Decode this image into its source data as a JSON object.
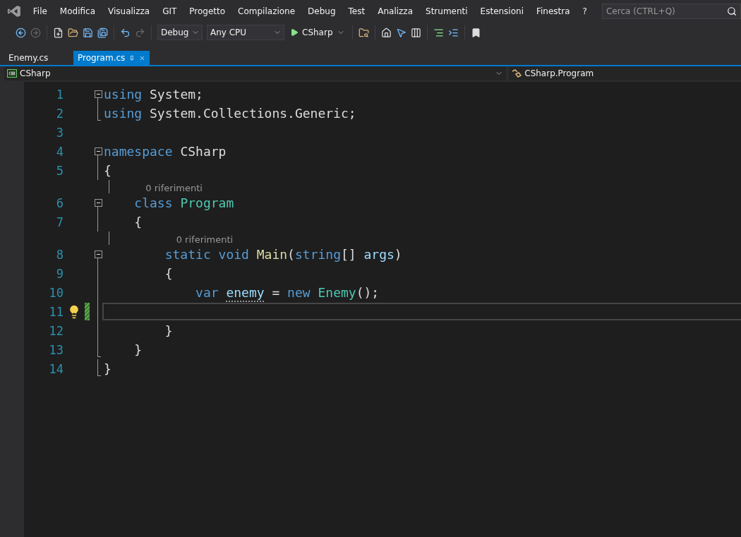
{
  "menu": {
    "items": [
      "File",
      "Modifica",
      "Visualizza",
      "GIT",
      "Progetto",
      "Compilazione",
      "Debug",
      "Test",
      "Analizza",
      "Strumenti",
      "Estensioni",
      "Finestra",
      "?"
    ]
  },
  "search": {
    "placeholder": "Cerca (CTRL+Q)"
  },
  "toolbar": {
    "configuration": "Debug",
    "platform": "Any CPU",
    "run_target": "CSharp"
  },
  "tabs": [
    {
      "label": "Enemy.cs",
      "selected": false
    },
    {
      "label": "Program.cs",
      "selected": true
    }
  ],
  "navigation": {
    "project": "CSharp",
    "member": "CSharp.Program"
  },
  "editor": {
    "lines": [
      {
        "number": "1",
        "kind": "fold-start",
        "tokens": [
          {
            "text": "using ",
            "kind": "keyword"
          },
          {
            "text": "System;",
            "kind": "plain"
          }
        ]
      },
      {
        "number": "2",
        "kind": "fold-end",
        "tokens": [
          {
            "text": "using ",
            "kind": "keyword"
          },
          {
            "text": "System.Collections.Generic;",
            "kind": "plain"
          }
        ]
      },
      {
        "number": "3",
        "kind": "blank"
      },
      {
        "number": "4",
        "kind": "fold-start",
        "tokens": [
          {
            "text": "namespace ",
            "kind": "keyword"
          },
          {
            "text": "CSharp",
            "kind": "plain"
          }
        ]
      },
      {
        "number": "5",
        "kind": "fold-body",
        "tokens": [
          {
            "text": "{",
            "kind": "plain"
          }
        ]
      },
      {
        "number": "6",
        "kind": "fold-start",
        "lens": "0 riferimenti",
        "tokens": [
          {
            "text": "    class ",
            "kind": "keyword"
          },
          {
            "text": "Program",
            "kind": "type"
          }
        ]
      },
      {
        "number": "7",
        "kind": "fold-body",
        "tokens": [
          {
            "text": "    {",
            "kind": "plain"
          }
        ]
      },
      {
        "number": "8",
        "kind": "fold-start",
        "lens": "0 riferimenti",
        "tokens": [
          {
            "text": "        static void ",
            "kind": "keyword"
          },
          {
            "text": "Main",
            "kind": "method"
          },
          {
            "text": "(",
            "kind": "plain"
          },
          {
            "text": "string",
            "kind": "keyword"
          },
          {
            "text": "[] ",
            "kind": "plain"
          },
          {
            "text": "args",
            "kind": "parameter"
          },
          {
            "text": ")",
            "kind": "plain"
          }
        ]
      },
      {
        "number": "9",
        "kind": "fold-body",
        "tokens": [
          {
            "text": "        {",
            "kind": "plain"
          }
        ]
      },
      {
        "number": "10",
        "kind": "fold-body",
        "tokens": [
          {
            "text": "            var ",
            "kind": "keyword"
          },
          {
            "text": "enemy",
            "kind": "hinted"
          },
          {
            "text": " = ",
            "kind": "plain"
          },
          {
            "text": "new ",
            "kind": "keyword"
          },
          {
            "text": "Enemy",
            "kind": "type"
          },
          {
            "text": "();",
            "kind": "plain"
          }
        ]
      },
      {
        "number": "11",
        "kind": "fold-body",
        "current": true,
        "lightbulb": true,
        "changed": true
      },
      {
        "number": "12",
        "kind": "fold-body",
        "tokens": [
          {
            "text": "        }",
            "kind": "plain"
          }
        ]
      },
      {
        "number": "13",
        "kind": "fold-end",
        "tokens": [
          {
            "text": "    }",
            "kind": "plain"
          }
        ]
      },
      {
        "number": "14",
        "kind": "fold-end",
        "tokens": [
          {
            "text": "}",
            "kind": "plain"
          }
        ]
      }
    ]
  }
}
